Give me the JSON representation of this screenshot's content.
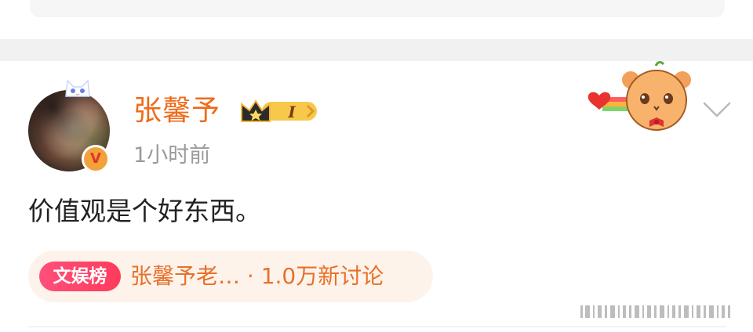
{
  "post": {
    "author": "张馨予",
    "level": "I",
    "time": "1小时前",
    "text": "价值观是个好东西。",
    "verified_mark": "V"
  },
  "topic": {
    "tag": "文娱榜",
    "text": "张馨予老… · 1.0万新讨论"
  },
  "icons": {
    "vip_badge": "verified-v-icon",
    "crown": "crown-level-icon",
    "bear": "bear-heart-decoration-icon",
    "chevron": "chevron-down-icon",
    "cat": "cat-ears-decoration-icon",
    "watermark": "barcode-watermark-icon"
  },
  "colors": {
    "username": "#f06a18",
    "topic_bg": "#fdf3ea",
    "topic_text": "#e8702a",
    "tag_bg": "#ff3b5c",
    "timestamp": "#9b9b9b"
  }
}
